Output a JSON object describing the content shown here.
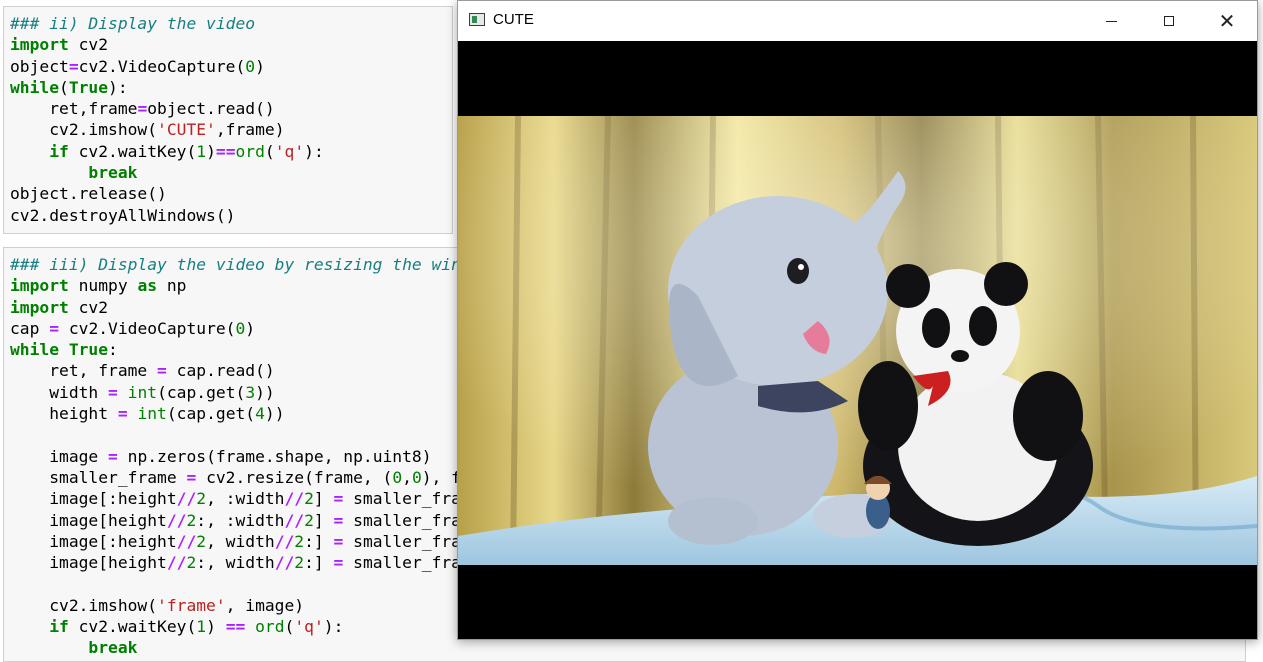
{
  "notebook": {
    "cells": [
      {
        "lines": [
          [
            [
              "c-comment",
              "### ii) Display the video"
            ]
          ],
          [
            [
              "c-kw",
              "import"
            ],
            [
              "",
              " cv2"
            ]
          ],
          [
            [
              "",
              "object"
            ],
            [
              "c-op",
              "="
            ],
            [
              "",
              "cv2.VideoCapture("
            ],
            [
              "c-num",
              "0"
            ],
            [
              "",
              ")"
            ]
          ],
          [
            [
              "c-kw",
              "while"
            ],
            [
              "",
              "("
            ],
            [
              "c-kw",
              "True"
            ],
            [
              "",
              "):"
            ]
          ],
          [
            [
              "",
              "    ret,frame"
            ],
            [
              "c-op",
              "="
            ],
            [
              "",
              "object.read()"
            ]
          ],
          [
            [
              "",
              "    cv2.imshow("
            ],
            [
              "c-str",
              "'CUTE'"
            ],
            [
              "",
              ",frame)"
            ]
          ],
          [
            [
              "",
              "    "
            ],
            [
              "c-kw",
              "if"
            ],
            [
              "",
              " cv2.waitKey("
            ],
            [
              "c-num",
              "1"
            ],
            [
              "",
              ")"
            ],
            [
              "c-op",
              "=="
            ],
            [
              "c-bi",
              "ord"
            ],
            [
              "",
              "("
            ],
            [
              "c-str",
              "'q'"
            ],
            [
              "",
              "):"
            ]
          ],
          [
            [
              "",
              "        "
            ],
            [
              "c-kw",
              "break"
            ]
          ],
          [
            [
              "",
              "object.release()"
            ]
          ],
          [
            [
              "",
              "cv2.destroyAllWindows()"
            ]
          ]
        ]
      },
      {
        "lines": [
          [
            [
              "c-comment",
              "### iii) Display the video by resizing the wind"
            ]
          ],
          [
            [
              "c-kw",
              "import"
            ],
            [
              "",
              " numpy "
            ],
            [
              "c-kw",
              "as"
            ],
            [
              "",
              " np"
            ]
          ],
          [
            [
              "c-kw",
              "import"
            ],
            [
              "",
              " cv2"
            ]
          ],
          [
            [
              "",
              "cap "
            ],
            [
              "c-op",
              "="
            ],
            [
              "",
              " cv2.VideoCapture("
            ],
            [
              "c-num",
              "0"
            ],
            [
              "",
              ")"
            ]
          ],
          [
            [
              "c-kw",
              "while"
            ],
            [
              "",
              " "
            ],
            [
              "c-kw",
              "True"
            ],
            [
              "",
              ":"
            ]
          ],
          [
            [
              "",
              "    ret, frame "
            ],
            [
              "c-op",
              "="
            ],
            [
              "",
              " cap.read()"
            ]
          ],
          [
            [
              "",
              "    width "
            ],
            [
              "c-op",
              "="
            ],
            [
              "",
              " "
            ],
            [
              "c-bi",
              "int"
            ],
            [
              "",
              "(cap.get("
            ],
            [
              "c-num",
              "3"
            ],
            [
              "",
              "))"
            ]
          ],
          [
            [
              "",
              "    height "
            ],
            [
              "c-op",
              "="
            ],
            [
              "",
              " "
            ],
            [
              "c-bi",
              "int"
            ],
            [
              "",
              "(cap.get("
            ],
            [
              "c-num",
              "4"
            ],
            [
              "",
              "))"
            ]
          ],
          [
            [
              "",
              ""
            ]
          ],
          [
            [
              "",
              "    image "
            ],
            [
              "c-op",
              "="
            ],
            [
              "",
              " np.zeros(frame.shape, np.uint8)"
            ]
          ],
          [
            [
              "",
              "    smaller_frame "
            ],
            [
              "c-op",
              "="
            ],
            [
              "",
              " cv2.resize(frame, ("
            ],
            [
              "c-num",
              "0"
            ],
            [
              "",
              ","
            ],
            [
              "c-num",
              "0"
            ],
            [
              "",
              "), fx"
            ]
          ],
          [
            [
              "",
              "    image[:height"
            ],
            [
              "c-op",
              "//"
            ],
            [
              "c-num",
              "2"
            ],
            [
              "",
              ", :width"
            ],
            [
              "c-op",
              "//"
            ],
            [
              "c-num",
              "2"
            ],
            [
              "",
              "] "
            ],
            [
              "c-op",
              "="
            ],
            [
              "",
              " smaller_fram"
            ]
          ],
          [
            [
              "",
              "    image[height"
            ],
            [
              "c-op",
              "//"
            ],
            [
              "c-num",
              "2"
            ],
            [
              "",
              ":, :width"
            ],
            [
              "c-op",
              "//"
            ],
            [
              "c-num",
              "2"
            ],
            [
              "",
              "] "
            ],
            [
              "c-op",
              "="
            ],
            [
              "",
              " smaller_fram"
            ]
          ],
          [
            [
              "",
              "    image[:height"
            ],
            [
              "c-op",
              "//"
            ],
            [
              "c-num",
              "2"
            ],
            [
              "",
              ", width"
            ],
            [
              "c-op",
              "//"
            ],
            [
              "c-num",
              "2"
            ],
            [
              "",
              ":] "
            ],
            [
              "c-op",
              "="
            ],
            [
              "",
              " smaller_fram"
            ]
          ],
          [
            [
              "",
              "    image[height"
            ],
            [
              "c-op",
              "//"
            ],
            [
              "c-num",
              "2"
            ],
            [
              "",
              ":, width"
            ],
            [
              "c-op",
              "//"
            ],
            [
              "c-num",
              "2"
            ],
            [
              "",
              ":] "
            ],
            [
              "c-op",
              "="
            ],
            [
              "",
              " smaller_fram"
            ]
          ],
          [
            [
              "",
              ""
            ]
          ],
          [
            [
              "",
              "    cv2.imshow("
            ],
            [
              "c-str",
              "'frame'"
            ],
            [
              "",
              ", image)"
            ]
          ],
          [
            [
              "",
              "    "
            ],
            [
              "c-kw",
              "if"
            ],
            [
              "",
              " cv2.waitKey("
            ],
            [
              "c-num",
              "1"
            ],
            [
              "",
              ") "
            ],
            [
              "c-op",
              "=="
            ],
            [
              "",
              " "
            ],
            [
              "c-bi",
              "ord"
            ],
            [
              "",
              "("
            ],
            [
              "c-str",
              "'q'"
            ],
            [
              "",
              "):"
            ]
          ],
          [
            [
              "",
              "        "
            ],
            [
              "c-kw",
              "break"
            ]
          ]
        ]
      }
    ]
  },
  "window": {
    "title": "CUTE",
    "icon": "opencv-window-icon",
    "controls": [
      "minimize-icon",
      "maximize-icon",
      "close-icon"
    ],
    "close_glyph": "✕"
  },
  "video": {
    "scene": "webcam frame: grey plush elephant with 'elephant' bib, black-and-white plush panda with red bow, small figurine, golden curtains background, blue blanket"
  },
  "colors": {
    "comment": "#177f80",
    "keyword": "#008000",
    "operator": "#aa22ff",
    "string": "#ba2121",
    "cell_bg": "#f7f7f7"
  }
}
